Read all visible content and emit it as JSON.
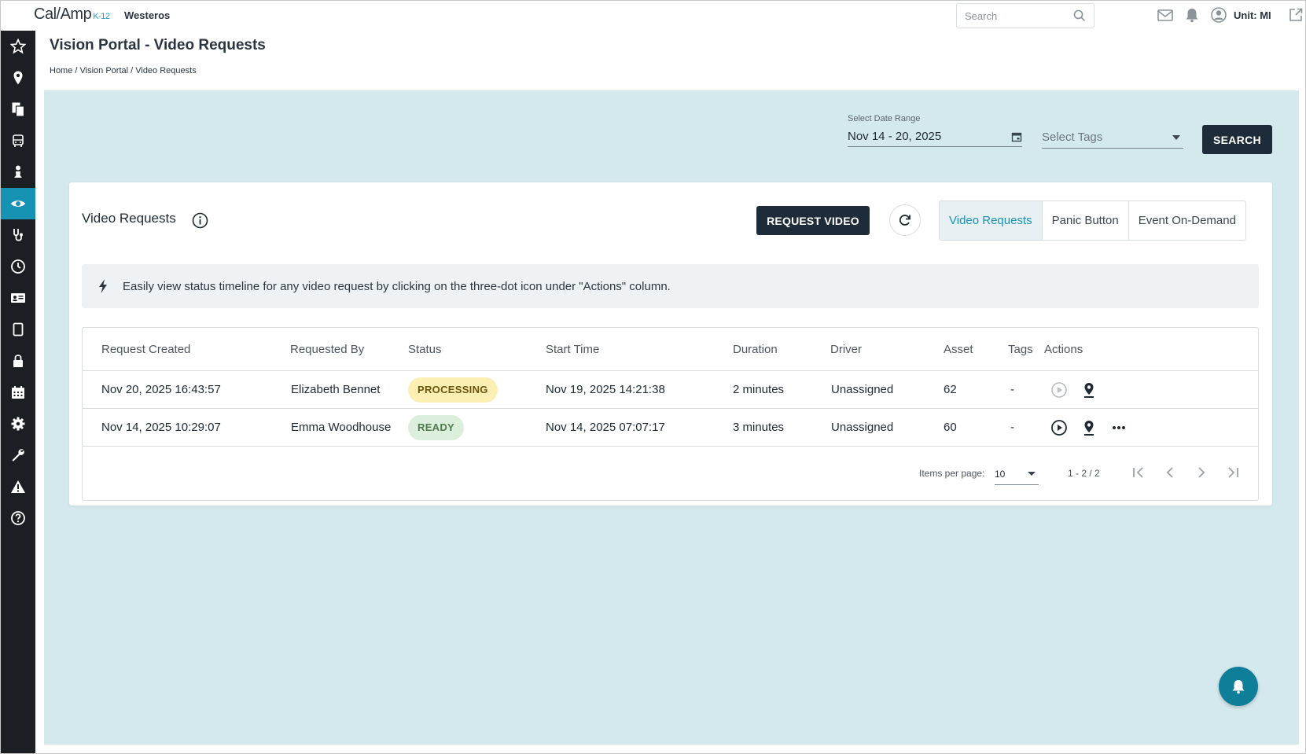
{
  "app": {
    "logo_main": "Cal/Amp",
    "logo_sub": "K-12",
    "org": "Westeros"
  },
  "topbar": {
    "search_placeholder": "Search",
    "unit_label": "Unit: MI"
  },
  "page": {
    "title": "Vision Portal - Video Requests",
    "breadcrumb": "Home / Vision Portal / Video Requests"
  },
  "filters": {
    "date_label": "Select Date Range",
    "date_value": "Nov 14 - 20, 2025",
    "tags_placeholder": "Select Tags",
    "search_button": "SEARCH"
  },
  "card": {
    "title": "Video Requests",
    "request_button": "REQUEST VIDEO",
    "tabs": [
      "Video Requests",
      "Panic Button",
      "Event On-Demand"
    ],
    "active_tab": 0,
    "banner": "Easily view status timeline for any video request by clicking on the three-dot icon under \"Actions\" column."
  },
  "table": {
    "headers": [
      "Request Created",
      "Requested By",
      "Status",
      "Start Time",
      "Duration",
      "Driver",
      "Asset",
      "Tags",
      "Actions"
    ],
    "rows": [
      {
        "created": "Nov 20, 2025 16:43:57",
        "by": "Elizabeth Bennet",
        "status": "PROCESSING",
        "start": "Nov 19, 2025 14:21:38",
        "duration": "2 minutes",
        "driver": "Unassigned",
        "asset": "62",
        "tags": "-"
      },
      {
        "created": "Nov 14, 2025 10:29:07",
        "by": "Emma Woodhouse",
        "status": "READY",
        "start": "Nov 14, 2025 07:07:17",
        "duration": "3 minutes",
        "driver": "Unassigned",
        "asset": "60",
        "tags": "-"
      }
    ]
  },
  "pager": {
    "items_per_page_label": "Items per page:",
    "items_per_page": "10",
    "range": "1 - 2 / 2"
  },
  "colors": {
    "accent": "#1693b3",
    "dark_button": "#1e2c3a",
    "panel_bg": "#d4e9ee",
    "sidebar": "#1b1e22"
  },
  "icons": {
    "sidebar": [
      "star-icon",
      "map-pin-icon",
      "documents-icon",
      "bus-icon",
      "person-icon",
      "eye-icon",
      "stethoscope-icon",
      "clock-icon",
      "id-card-icon",
      "tablet-icon",
      "lock-icon",
      "calendar-icon",
      "gear-icon",
      "wrench-icon",
      "warning-icon",
      "help-icon"
    ]
  }
}
